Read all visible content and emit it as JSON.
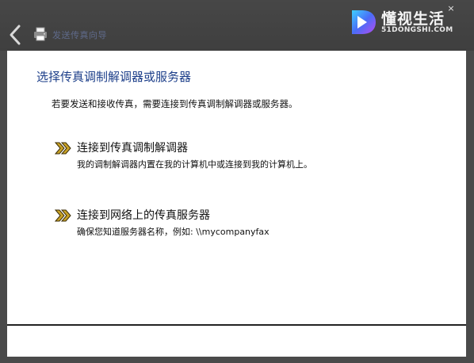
{
  "window": {
    "title": "发送传真向导",
    "back_icon": "back-arrow-icon",
    "app_icon": "fax-printer-icon",
    "close_glyph": "×"
  },
  "watermark": {
    "title": "懂视生活",
    "subtitle": "51DONGSHI.COM",
    "logo_icon": "d-logo"
  },
  "main": {
    "heading": "选择传真调制解调器或服务器",
    "description": "若要发送和接收传真，需要连接到传真调制解调器或服务器。",
    "options": [
      {
        "title": "连接到传真调制解调器",
        "description": "我的调制解调器内置在我的计算机中或连接到我的计算机上。",
        "icon": "double-chevron-right-icon"
      },
      {
        "title": "连接到网络上的传真服务器",
        "description": "确保您知道服务器名称，例如: \\\\mycompanyfax",
        "icon": "double-chevron-right-icon"
      }
    ]
  },
  "colors": {
    "heading": "#1d3f8a",
    "titlebar": "#444444",
    "arrow_gold": "#c9a227"
  }
}
